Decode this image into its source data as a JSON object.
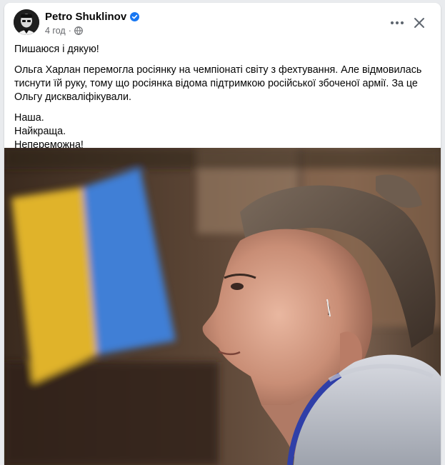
{
  "post": {
    "author": "Petro Shuklinov",
    "time": "4 год",
    "separator": "·",
    "icons": {
      "verified": "verified-badge-icon",
      "privacy": "globe-icon",
      "more": "more-horizontal-icon",
      "close": "close-icon"
    },
    "colors": {
      "verified": "#1877f2",
      "secondary_text": "#65676b"
    },
    "text": {
      "line1": "Пишаюся і дякую!",
      "line2": "Ольга Харлан перемогла росіянку на чемпіонаті світу з фехтування. Але відмовилась тиснути їй руку, тому що росіянка відома підтримкою російської збоченої армії. За це Ольгу дискваліфікували.",
      "line3": "Наша.",
      "line4": "Найкраща.",
      "line5": "Непереможна!"
    }
  }
}
